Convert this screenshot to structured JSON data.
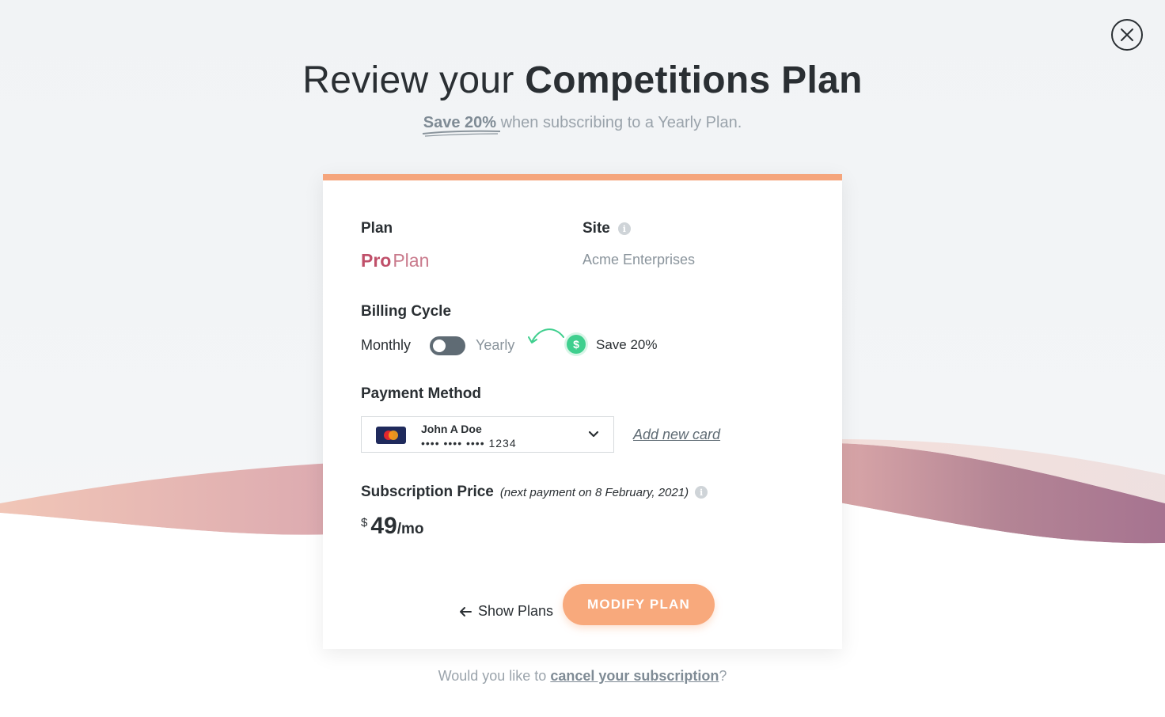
{
  "header": {
    "title_light": "Review your",
    "title_strong": "Competitions Plan",
    "subtitle_highlight": "Save 20%",
    "subtitle_rest": "when subscribing to a Yearly Plan."
  },
  "card": {
    "plan_label": "Plan",
    "plan_value_bold": "Pro",
    "plan_value_rest": "Plan",
    "site_label": "Site",
    "site_value": "Acme Enterprises",
    "billing_label": "Billing Cycle",
    "billing_monthly": "Monthly",
    "billing_yearly": "Yearly",
    "billing_save": "Save 20%",
    "billing_toggle_yearly": false,
    "payment_label": "Payment Method",
    "card_holder": "John A Doe",
    "card_number": "•••• •••• •••• 1234",
    "add_card": "Add new card",
    "subscription_label": "Subscription Price",
    "subscription_note": "(next payment on 8 February, 2021)",
    "price_currency": "$",
    "price_amount": "49",
    "price_period": "/mo",
    "show_plans": "Show Plans",
    "modify_plan": "MODIFY PLAN"
  },
  "footer": {
    "cancel_prefix": "Would you like to",
    "cancel_link": "cancel your subscription",
    "cancel_suffix": "?"
  },
  "colors": {
    "accent_orange": "#f8a97c",
    "plan_pink": "#c0506a",
    "save_green": "#3fcf8e",
    "toggle_grey": "#5f6b74"
  },
  "icons": {
    "close": "close-icon",
    "info": "info-icon",
    "dollar": "dollar-icon",
    "card_brand": "mastercard-icon",
    "dropdown": "chevron-down-icon",
    "back": "arrow-left-icon"
  }
}
